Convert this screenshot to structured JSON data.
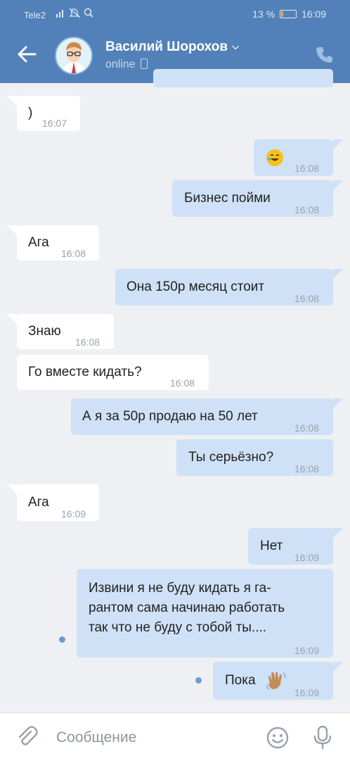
{
  "status_bar": {
    "carrier": "Tele2",
    "battery": "13 %",
    "battery_level": 0.13,
    "time": "16:09"
  },
  "header": {
    "contact_name": "Василий Шорохов",
    "contact_status": "online"
  },
  "messages": [
    {
      "dir": "in",
      "text": ")",
      "time": "16:07"
    },
    {
      "dir": "out",
      "emoji": "rolling-on-floor-laughing-emoji",
      "text": "",
      "time": "16:08"
    },
    {
      "dir": "out",
      "text": "Бизнес пойми",
      "time": "16:08"
    },
    {
      "dir": "in",
      "text": "Ага",
      "time": "16:08"
    },
    {
      "dir": "out",
      "text": "Она 150р месяц стоит",
      "time": "16:08"
    },
    {
      "dir": "in",
      "text": "Знаю",
      "time": "16:08"
    },
    {
      "dir": "in",
      "text": "Го вместе кидать?",
      "time": "16:08"
    },
    {
      "dir": "out",
      "text": "А я за 50р продаю на 50 лет",
      "time": "16:08"
    },
    {
      "dir": "out",
      "text": "Ты серьёзно?",
      "time": "16:08"
    },
    {
      "dir": "in",
      "text": "Ага",
      "time": "16:09"
    },
    {
      "dir": "out",
      "text": "Нет",
      "time": "16:09"
    },
    {
      "dir": "out",
      "lines": [
        "Извини я не буду кидать я га-",
        "рантом сама начинаю работать",
        "так что не буду с тобой ты...."
      ],
      "time": "16:09",
      "unread": true
    },
    {
      "dir": "out",
      "text": "Пока",
      "emoji": "waving-hand-emoji",
      "time": "16:09",
      "unread": true
    }
  ],
  "composer": {
    "placeholder": "Сообщение"
  },
  "icons": {
    "back": "arrow-left-icon",
    "call": "phone-icon",
    "attach": "paperclip-icon",
    "emoji": "smiley-icon",
    "voice": "microphone-icon"
  },
  "colors": {
    "header": "#5181b8",
    "outgoing_bubble": "#cfe1f6",
    "incoming_bubble": "#ffffff",
    "background": "#eef0f3"
  }
}
